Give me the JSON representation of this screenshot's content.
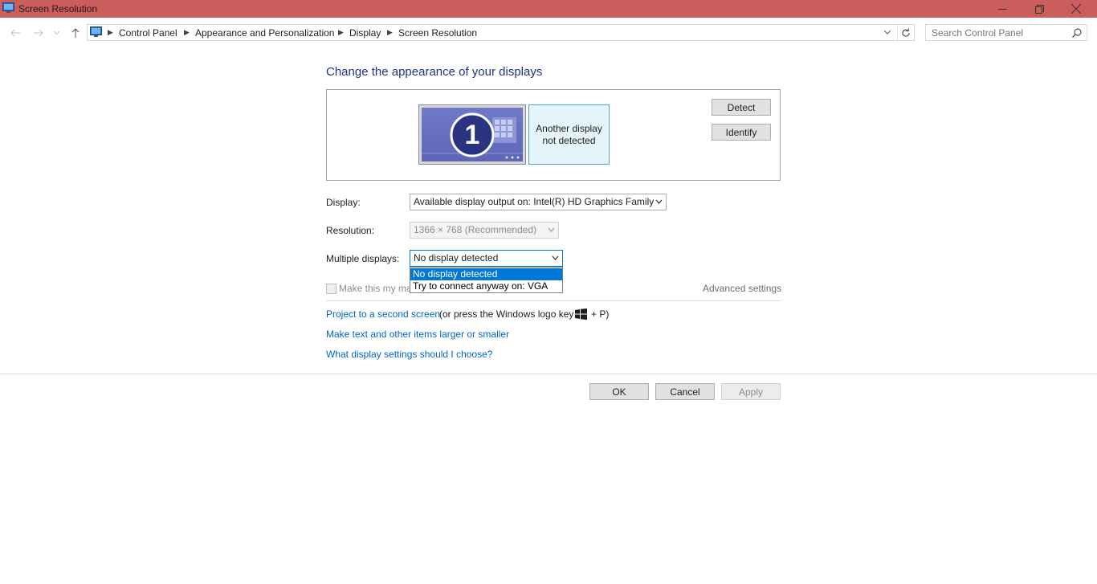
{
  "window": {
    "title": "Screen Resolution",
    "titlebar_color": "#cc5d5d"
  },
  "breadcrumb": [
    "Control Panel",
    "Appearance and Personalization",
    "Display",
    "Screen Resolution"
  ],
  "search": {
    "placeholder": "Search Control Panel"
  },
  "heading": "Change the appearance of your displays",
  "displays": {
    "monitor_1_number": "1",
    "monitor_2_text": "Another display not detected"
  },
  "buttons": {
    "detect": "Detect",
    "identify": "Identify",
    "ok": "OK",
    "cancel": "Cancel",
    "apply": "Apply"
  },
  "settings": {
    "display_label": "Display:",
    "display_value": "Available display output on: Intel(R) HD Graphics Family",
    "resolution_label": "Resolution:",
    "resolution_value": "1366 × 768 (Recommended)",
    "multiple_label": "Multiple displays:",
    "multiple_value": "No display detected",
    "multiple_options": [
      "No display detected",
      "Try to connect anyway on: VGA"
    ],
    "main_display_checkbox_label": "Make this my ma",
    "advanced_link": "Advanced settings"
  },
  "links": {
    "project": "Project to a second screen",
    "project_suffix": "(or press the Windows logo key",
    "project_key": "+ P)",
    "text_size": "Make text and other items larger or smaller",
    "display_help": "What display settings should I choose?"
  },
  "colors": {
    "link": "#0066cc",
    "heading": "#1e3287",
    "selection": "#0078d7",
    "monitor_fill": "#5d66b8"
  },
  "icons": [
    "control-panel-icon",
    "back-arrow-icon",
    "forward-arrow-icon",
    "up-arrow-icon",
    "refresh-icon",
    "search-icon",
    "minimize-icon",
    "maximize-icon",
    "close-icon",
    "windows-logo-icon"
  ]
}
